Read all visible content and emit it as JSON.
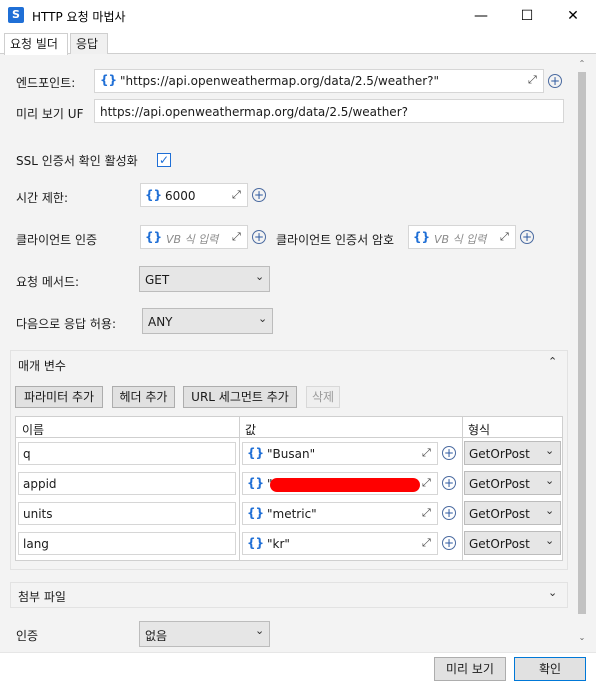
{
  "window": {
    "title": "HTTP 요청 마법사",
    "app_icon_letter": "S"
  },
  "tabs": [
    {
      "label": "요청 빌더",
      "active": true
    },
    {
      "label": "응답",
      "active": false
    }
  ],
  "form": {
    "endpoint_label": "엔드포인트:",
    "endpoint_value": "\"https://api.openweathermap.org/data/2.5/weather?\"",
    "preview_label": "미리 보기 UF",
    "preview_value": "https://api.openweathermap.org/data/2.5/weather?",
    "ssl_label": "SSL 인증서 확인 활성화",
    "ssl_checked": true,
    "timeout_label": "시간 제한:",
    "timeout_value": "6000",
    "client_cert_label": "클라이언트 인증",
    "client_cert_placeholder": "VB 식 입력",
    "client_cert_pw_label": "클라이언트 인증서 암호",
    "client_cert_pw_placeholder": "VB 식 입력",
    "method_label": "요청 메서드:",
    "method_value": "GET",
    "accept_label": "다음으로 응답 허용:",
    "accept_value": "ANY",
    "auth_label": "인증",
    "auth_value": "없음"
  },
  "params_section": {
    "title": "매개 변수",
    "buttons": {
      "add_param": "파라미터 추가",
      "add_header": "헤더 추가",
      "add_url_segment": "URL 세그먼트 추가",
      "delete": "삭제"
    },
    "columns": {
      "name": "이름",
      "value": "값",
      "type": "형식"
    },
    "rows": [
      {
        "name": "q",
        "value": "\"Busan\"",
        "type": "GetOrPost"
      },
      {
        "name": "appid",
        "value": "\"",
        "type": "GetOrPost"
      },
      {
        "name": "units",
        "value": "\"metric\"",
        "type": "GetOrPost"
      },
      {
        "name": "lang",
        "value": "\"kr\"",
        "type": "GetOrPost"
      }
    ]
  },
  "attachments_section": {
    "title": "첨부 파일"
  },
  "footer": {
    "preview_button": "미리 보기",
    "ok_button": "확인"
  },
  "glyphs": {
    "braces": "{}",
    "expand": "⤢",
    "plus": "+",
    "chevron_down": "⌄",
    "chevron_up": "⌃",
    "check": "✓",
    "minimize": "—",
    "maximize": "☐",
    "close": "✕"
  }
}
